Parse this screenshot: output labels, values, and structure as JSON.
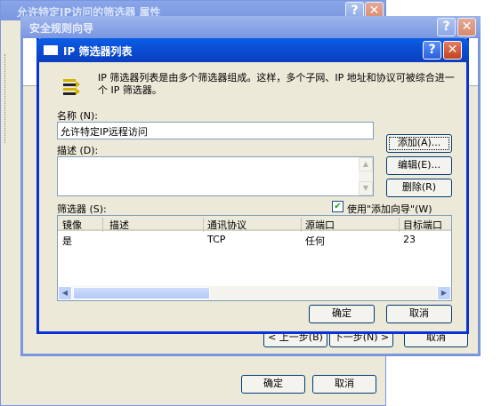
{
  "background_window": {
    "title": "允许特定IP访问的筛选器 属性",
    "help_glyph": "?",
    "close_glyph": "✕",
    "ok_label": "确定",
    "cancel_label": "取消"
  },
  "wizard_window": {
    "title": "安全规则向导",
    "help_glyph": "?",
    "close_glyph": "✕",
    "back_label": "< 上一步(B)",
    "next_label": "下一步(N) >",
    "cancel_label": "取消"
  },
  "dialog": {
    "title": "IP 筛选器列表",
    "help_glyph": "?",
    "close_glyph": "✕",
    "description": "IP 筛选器列表是由多个筛选器组成。这样，多个子网、IP 地址和协议可被综合进一个 IP 筛选器。",
    "name_label": "名称 (N):",
    "name_value": "允许特定IP远程访问",
    "desc_label": "描述 (D):",
    "desc_value": "",
    "add_button": "添加(A)...",
    "edit_button": "编辑(E)...",
    "delete_button": "删除(R)",
    "filters_label": "筛选器 (S):",
    "use_wizard_label": "使用\"添加向导\"(W)",
    "use_wizard_checked": true,
    "table": {
      "columns": [
        "镜像",
        "描述",
        "通讯协议",
        "源端口",
        "目标端口"
      ],
      "rows": [
        [
          "是",
          "",
          "TCP",
          "任何",
          "23"
        ]
      ]
    },
    "ok_button": "确定",
    "cancel_button": "取消"
  },
  "colors": {
    "titlebar_active": "#0a4fd6",
    "titlebar_inactive": "#7a96df",
    "dialog_face": "#ece9d8",
    "frame_border": "#0831d9"
  },
  "icons": {
    "dialog_title_icon": "window-icon",
    "filter_list_icon": "filter-list-icon",
    "check_mark": "✔"
  }
}
